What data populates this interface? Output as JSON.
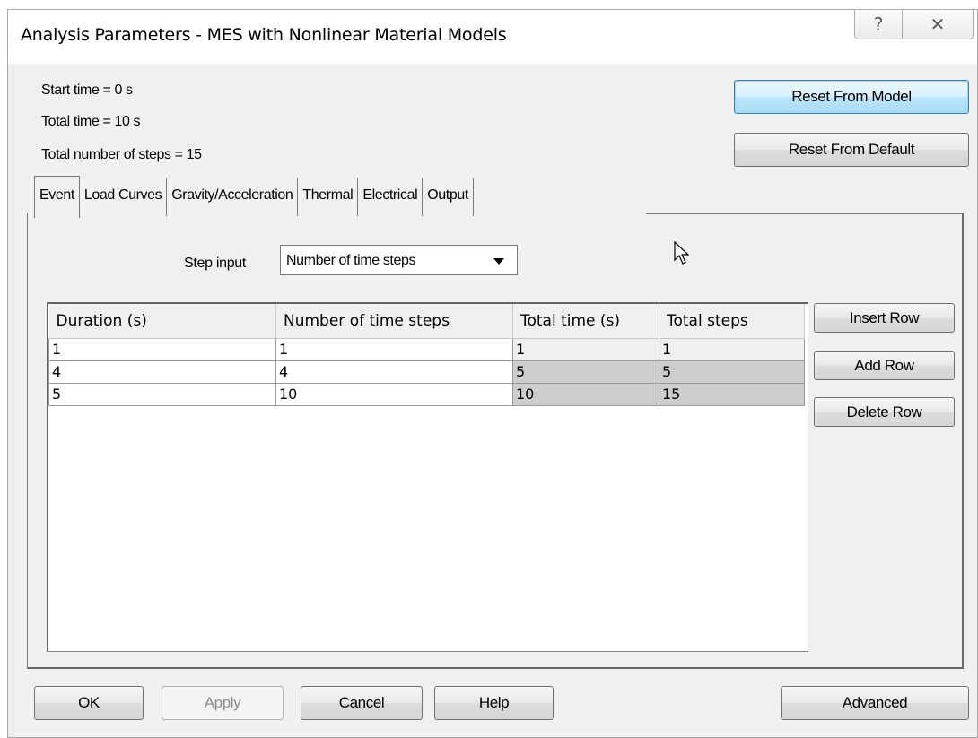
{
  "window": {
    "title": "Analysis Parameters - MES with Nonlinear Material Models",
    "help_glyph": "?",
    "close_glyph": "✕"
  },
  "info": {
    "start_time": "Start time = 0 s",
    "total_time": "Total time = 10 s",
    "total_steps": "Total number of steps = 15"
  },
  "top_buttons": {
    "reset_model": "Reset From Model",
    "reset_default": "Reset From Default"
  },
  "tabs": [
    {
      "label": "Event",
      "active": true
    },
    {
      "label": "Load Curves"
    },
    {
      "label": "Gravity/Acceleration"
    },
    {
      "label": "Thermal"
    },
    {
      "label": "Electrical"
    },
    {
      "label": "Output"
    }
  ],
  "step_input": {
    "label": "Step input",
    "value": "Number of time steps"
  },
  "table": {
    "headers": [
      "Duration (s)",
      "Number of time steps",
      "Total time (s)",
      "Total steps"
    ],
    "rows": [
      [
        "1",
        "1",
        "1",
        "1"
      ],
      [
        "4",
        "4",
        "5",
        "5"
      ],
      [
        "5",
        "10",
        "10",
        "15"
      ]
    ]
  },
  "row_buttons": {
    "insert": "Insert Row",
    "add": "Add Row",
    "delete": "Delete Row"
  },
  "bottom_buttons": {
    "ok": "OK",
    "apply": "Apply",
    "cancel": "Cancel",
    "help": "Help",
    "advanced": "Advanced"
  },
  "colors": {
    "default_button_border": "#3c7fb1",
    "readonly_cell": "#cdcdcd"
  }
}
